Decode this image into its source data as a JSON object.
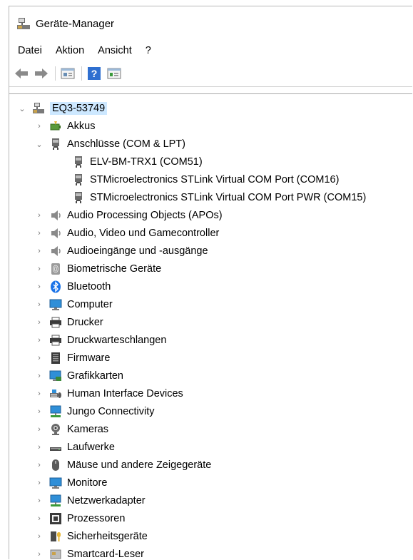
{
  "window": {
    "title": "Geräte-Manager"
  },
  "menu": [
    "Datei",
    "Aktion",
    "Ansicht",
    "?"
  ],
  "toolbar": [
    "back-icon",
    "forward-icon",
    "properties-icon",
    "help-icon",
    "scan-icon"
  ],
  "tree": {
    "root": {
      "label": "EQ3-53749",
      "expanded": true,
      "icon": "computer-tree-icon"
    },
    "items": [
      {
        "label": "Akkus",
        "icon": "battery-icon",
        "expanded": false
      },
      {
        "label": "Anschlüsse (COM & LPT)",
        "icon": "port-icon",
        "expanded": true,
        "children": [
          {
            "label": "ELV-BM-TRX1 (COM51)",
            "icon": "port-icon"
          },
          {
            "label": "STMicroelectronics STLink Virtual COM Port (COM16)",
            "icon": "port-icon"
          },
          {
            "label": "STMicroelectronics STLink Virtual COM Port PWR (COM15)",
            "icon": "port-icon"
          }
        ]
      },
      {
        "label": "Audio Processing Objects (APOs)",
        "icon": "speaker-icon",
        "expanded": false
      },
      {
        "label": "Audio, Video und Gamecontroller",
        "icon": "speaker-icon",
        "expanded": false
      },
      {
        "label": "Audioeingänge und -ausgänge",
        "icon": "speaker-icon",
        "expanded": false
      },
      {
        "label": "Biometrische Geräte",
        "icon": "fingerprint-icon",
        "expanded": false
      },
      {
        "label": "Bluetooth",
        "icon": "bluetooth-icon",
        "expanded": false
      },
      {
        "label": "Computer",
        "icon": "monitor-icon",
        "expanded": false
      },
      {
        "label": "Drucker",
        "icon": "printer-icon",
        "expanded": false
      },
      {
        "label": "Druckwarteschlangen",
        "icon": "printer-icon",
        "expanded": false
      },
      {
        "label": "Firmware",
        "icon": "firmware-icon",
        "expanded": false
      },
      {
        "label": "Grafikkarten",
        "icon": "display-adapter-icon",
        "expanded": false
      },
      {
        "label": "Human Interface Devices",
        "icon": "hid-icon",
        "expanded": false
      },
      {
        "label": "Jungo Connectivity",
        "icon": "network-icon",
        "expanded": false
      },
      {
        "label": "Kameras",
        "icon": "webcam-icon",
        "expanded": false
      },
      {
        "label": "Laufwerke",
        "icon": "drive-icon",
        "expanded": false
      },
      {
        "label": "Mäuse und andere Zeigegeräte",
        "icon": "mouse-icon",
        "expanded": false
      },
      {
        "label": "Monitore",
        "icon": "monitor-icon",
        "expanded": false
      },
      {
        "label": "Netzwerkadapter",
        "icon": "network-icon",
        "expanded": false
      },
      {
        "label": "Prozessoren",
        "icon": "processor-icon",
        "expanded": false
      },
      {
        "label": "Sicherheitsgeräte",
        "icon": "security-icon",
        "expanded": false
      },
      {
        "label": "Smartcard-Leser",
        "icon": "smartcard-icon",
        "expanded": false
      }
    ]
  },
  "colors": {
    "selection": "#cde8ff",
    "bluetooth": "#1a73e8",
    "monitor": "#2f8fd8"
  }
}
